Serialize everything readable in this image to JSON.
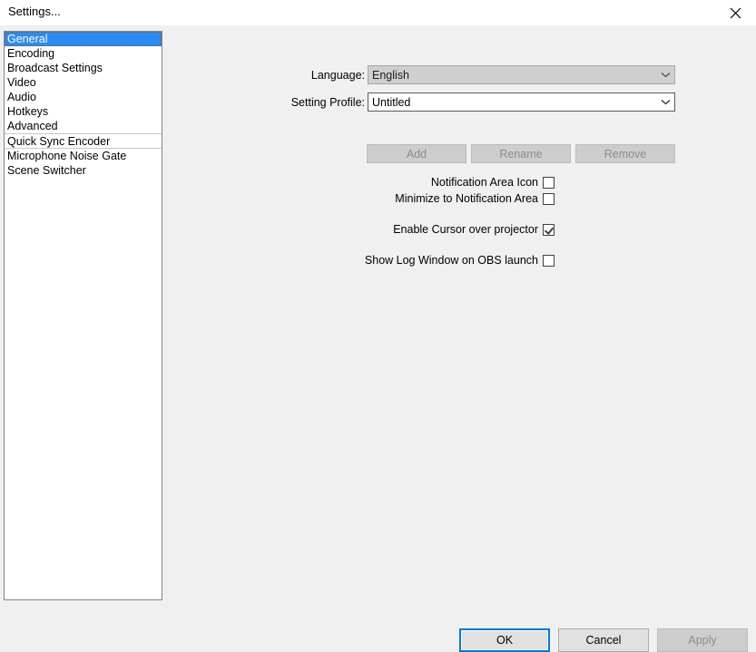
{
  "window": {
    "title": "Settings...",
    "close_icon": "close-icon"
  },
  "sidebar": {
    "items": [
      {
        "label": "General",
        "selected": true
      },
      {
        "label": "Encoding",
        "selected": false
      },
      {
        "label": "Broadcast Settings",
        "selected": false
      },
      {
        "label": "Video",
        "selected": false
      },
      {
        "label": "Audio",
        "selected": false
      },
      {
        "label": "Hotkeys",
        "selected": false
      },
      {
        "label": "Advanced",
        "selected": false
      },
      {
        "label": "Quick Sync Encoder",
        "selected": false
      },
      {
        "label": "Microphone Noise Gate",
        "selected": false
      },
      {
        "label": "Scene Switcher",
        "selected": false
      }
    ]
  },
  "form": {
    "language": {
      "label": "Language:",
      "value": "English",
      "arrow_icon": "chevron-down-icon"
    },
    "setting_profile": {
      "label": "Setting Profile:",
      "value": "Untitled",
      "arrow_icon": "chevron-down-icon"
    },
    "profile_buttons": {
      "add": "Add",
      "rename": "Rename",
      "remove": "Remove"
    },
    "checkboxes": [
      {
        "label": "Notification Area Icon",
        "checked": false
      },
      {
        "label": "Minimize to Notification Area",
        "checked": false
      },
      {
        "label": "Enable Cursor over projector",
        "checked": true
      },
      {
        "label": "Show Log Window on OBS launch",
        "checked": false
      }
    ]
  },
  "footer": {
    "ok": "OK",
    "cancel": "Cancel",
    "apply": "Apply"
  },
  "colors": {
    "accent": "#2a8bf2",
    "focus": "#0078d7",
    "window_bg": "#f0f0f0",
    "list_bg": "#ffffff"
  }
}
